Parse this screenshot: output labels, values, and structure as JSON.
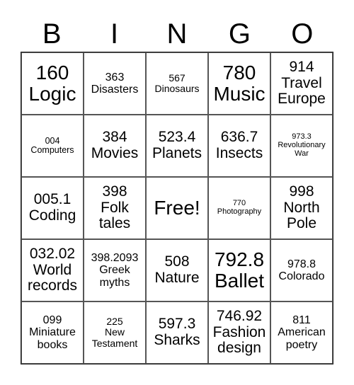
{
  "header": [
    "B",
    "I",
    "N",
    "G",
    "O"
  ],
  "cells": [
    {
      "text": "160\nLogic",
      "size": "xl"
    },
    {
      "text": "363\nDisasters",
      "size": "m"
    },
    {
      "text": "567\nDinosaurs",
      "size": "s"
    },
    {
      "text": "780\nMusic",
      "size": "xl"
    },
    {
      "text": "914\nTravel\nEurope",
      "size": "l"
    },
    {
      "text": "004\nComputers",
      "size": "xs"
    },
    {
      "text": "384\nMovies",
      "size": "l"
    },
    {
      "text": "523.4\nPlanets",
      "size": "l"
    },
    {
      "text": "636.7\nInsects",
      "size": "l"
    },
    {
      "text": "973.3\nRevolutionary\nWar",
      "size": "xxs"
    },
    {
      "text": "005.1\nCoding",
      "size": "l"
    },
    {
      "text": "398\nFolk\ntales",
      "size": "l"
    },
    {
      "text": "Free!",
      "size": "xl"
    },
    {
      "text": "770\nPhotography",
      "size": "xxs"
    },
    {
      "text": "998\nNorth\nPole",
      "size": "l"
    },
    {
      "text": "032.02\nWorld\nrecords",
      "size": "l"
    },
    {
      "text": "398.2093\nGreek\nmyths",
      "size": "m"
    },
    {
      "text": "508\nNature",
      "size": "l"
    },
    {
      "text": "792.8\nBallet",
      "size": "xl"
    },
    {
      "text": "978.8\nColorado",
      "size": "m"
    },
    {
      "text": "099\nMiniature\nbooks",
      "size": "m"
    },
    {
      "text": "225\nNew\nTestament",
      "size": "s"
    },
    {
      "text": "597.3\nSharks",
      "size": "l"
    },
    {
      "text": "746.92\nFashion\ndesign",
      "size": "l"
    },
    {
      "text": "811\nAmerican\npoetry",
      "size": "m"
    }
  ]
}
